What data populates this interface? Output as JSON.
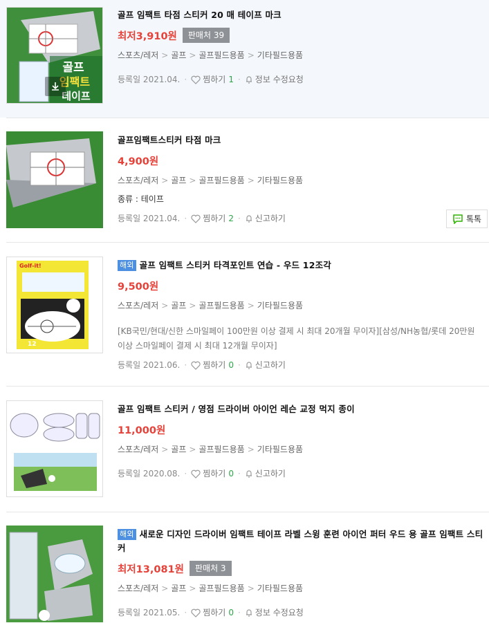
{
  "items": [
    {
      "title": "골프 임팩트 타점 스티커 20 매 테이프 마크",
      "price": "최저3,910원",
      "sellers": "판매처 39",
      "categories": [
        "스포츠/레저",
        "골프",
        "골프필드용품",
        "기타필드용품"
      ],
      "registered": "등록일 2021.04.",
      "wish_label": "찜하기",
      "wish_count": "1",
      "action": "정보 수정요청"
    },
    {
      "title": "골프임팩트스티커 타점 마크",
      "price": "4,900원",
      "categories": [
        "스포츠/레저",
        "골프",
        "골프필드용품",
        "기타필드용품"
      ],
      "spec": "종류 : 테이프",
      "registered": "등록일 2021.04.",
      "wish_label": "찜하기",
      "wish_count": "2",
      "action": "신고하기",
      "talk": "톡톡"
    },
    {
      "badge": "해외",
      "title": "골프 임팩트 스티커 타격포인트 연습 - 우드 12조각",
      "price": "9,500원",
      "categories": [
        "스포츠/레저",
        "골프",
        "골프필드용품",
        "기타필드용품"
      ],
      "desc": "[KB국민/현대/신한 스마일페이 100만원 이상 결제 시 최대 20개월 무이자][삼성/NH농협/롯데 20만원 이상 스마일페이 결제 시 최대 12개월 무이자]",
      "registered": "등록일 2021.06.",
      "wish_label": "찜하기",
      "wish_count": "0",
      "action": "신고하기"
    },
    {
      "title": "골프 임팩트 스티커 / 영점 드라이버 아이언 레슨 교정 먹지 종이",
      "price": "11,000원",
      "categories": [
        "스포츠/레저",
        "골프",
        "골프필드용품",
        "기타필드용품"
      ],
      "registered": "등록일 2020.08.",
      "wish_label": "찜하기",
      "wish_count": "0",
      "action": "신고하기"
    },
    {
      "badge": "해외",
      "title": "새로운 디자인 드라이버 임팩트 테이프 라벨 스윙 훈련 아이언 퍼터 우드 용 골프 임팩트 스티커",
      "price": "최저13,081원",
      "sellers": "판매처 3",
      "categories": [
        "스포츠/레저",
        "골프",
        "골프필드용품",
        "기타필드용품"
      ],
      "registered": "등록일 2021.05.",
      "wish_label": "찜하기",
      "wish_count": "0",
      "action": "정보 수정요청"
    }
  ],
  "thumb_text": {
    "item1_overlay": [
      "골프",
      "임팩트",
      "테이프"
    ],
    "item3_brand": "Golf-it!",
    "item3_number": "12"
  },
  "colors": {
    "price_red": "#e5423a",
    "count_green": "#2fa54a",
    "overseas_blue": "#4d8fe0",
    "sellers_gray": "#8e9196",
    "highlight_bg": "#f4f7fb"
  },
  "icons": {
    "wish": "heart-icon",
    "report": "bell-icon",
    "talk": "chat-bubble-icon",
    "download": "download-icon"
  }
}
